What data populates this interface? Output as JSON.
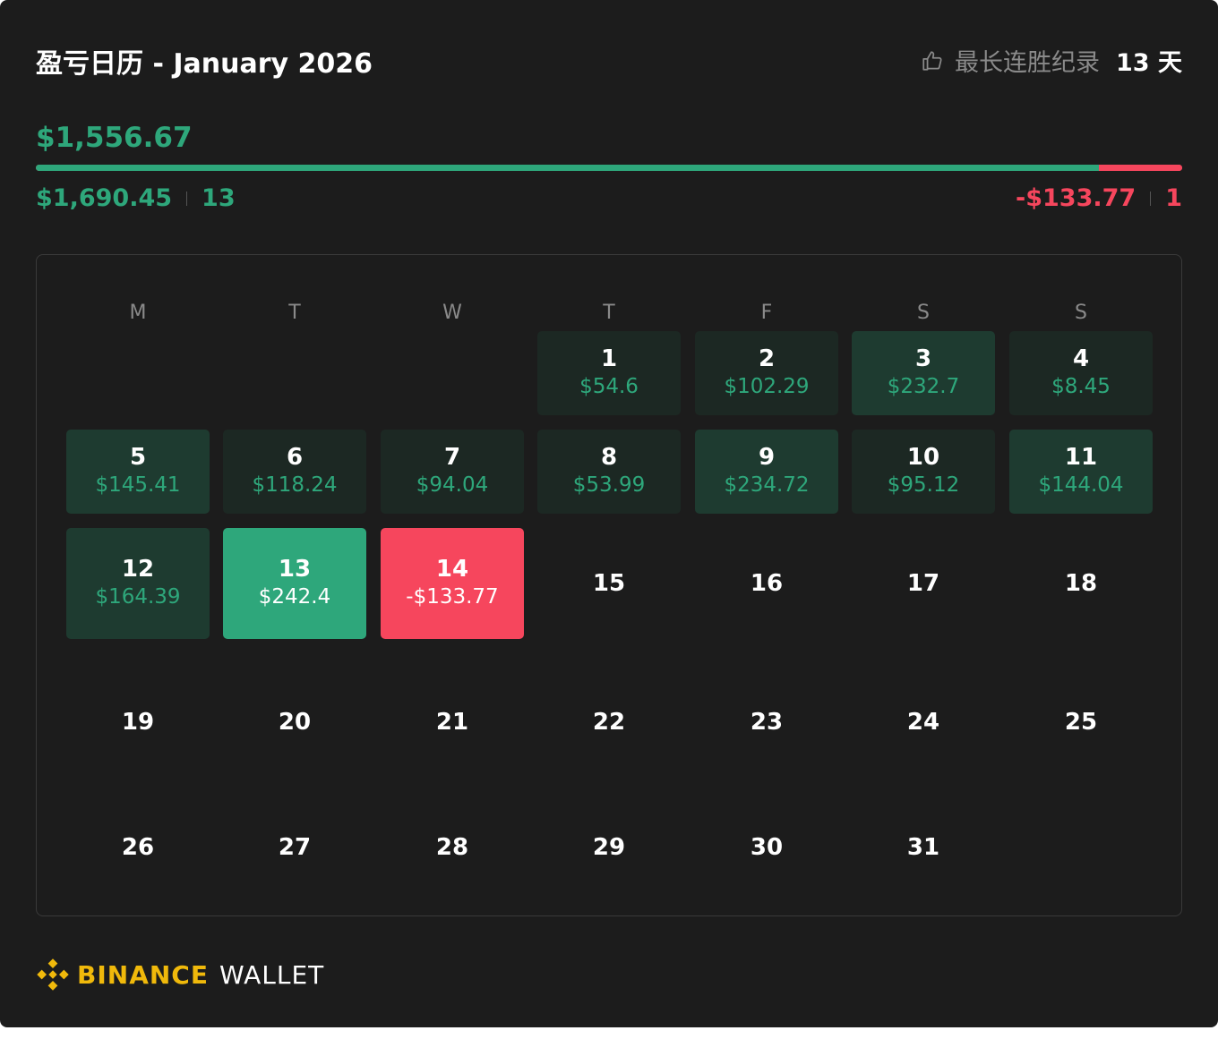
{
  "header": {
    "title": "盈亏日历 - January 2026",
    "streak_label": "最长连胜纪录",
    "streak_value": "13 天",
    "streak_icon": "thumbs-up-icon"
  },
  "summary": {
    "net_pnl": "$1,556.67",
    "profit_share": 0.927,
    "profit_total": "$1,690.45",
    "profit_days": "13",
    "loss_total": "-$133.77",
    "loss_days": "1"
  },
  "colors": {
    "profit": "#2ea77b",
    "loss": "#f6465d",
    "profit_cell_dim": "#1c2823",
    "profit_cell_mid": "#1e3b30",
    "profit_cell_strong": "#2ea77b",
    "loss_cell": "#f6465d"
  },
  "calendar": {
    "weekdays": [
      "M",
      "T",
      "W",
      "T",
      "F",
      "S",
      "S"
    ],
    "first_weekday_index": 3,
    "days": [
      {
        "day": "1",
        "pnl": "$54.6",
        "level": "dim"
      },
      {
        "day": "2",
        "pnl": "$102.29",
        "level": "dim"
      },
      {
        "day": "3",
        "pnl": "$232.7",
        "level": "mid"
      },
      {
        "day": "4",
        "pnl": "$8.45",
        "level": "dim"
      },
      {
        "day": "5",
        "pnl": "$145.41",
        "level": "mid"
      },
      {
        "day": "6",
        "pnl": "$118.24",
        "level": "dim"
      },
      {
        "day": "7",
        "pnl": "$94.04",
        "level": "dim"
      },
      {
        "day": "8",
        "pnl": "$53.99",
        "level": "dim"
      },
      {
        "day": "9",
        "pnl": "$234.72",
        "level": "mid"
      },
      {
        "day": "10",
        "pnl": "$95.12",
        "level": "dim"
      },
      {
        "day": "11",
        "pnl": "$144.04",
        "level": "mid"
      },
      {
        "day": "12",
        "pnl": "$164.39",
        "level": "mid"
      },
      {
        "day": "13",
        "pnl": "$242.4",
        "level": "strong"
      },
      {
        "day": "14",
        "pnl": "-$133.77",
        "level": "loss"
      },
      {
        "day": "15"
      },
      {
        "day": "16"
      },
      {
        "day": "17"
      },
      {
        "day": "18"
      },
      {
        "day": "19"
      },
      {
        "day": "20"
      },
      {
        "day": "21"
      },
      {
        "day": "22"
      },
      {
        "day": "23"
      },
      {
        "day": "24"
      },
      {
        "day": "25"
      },
      {
        "day": "26"
      },
      {
        "day": "27"
      },
      {
        "day": "28"
      },
      {
        "day": "29"
      },
      {
        "day": "30"
      },
      {
        "day": "31"
      }
    ]
  },
  "footer": {
    "brand": "BINANCE",
    "product": "WALLET",
    "logo_icon": "binance-logo-icon"
  }
}
